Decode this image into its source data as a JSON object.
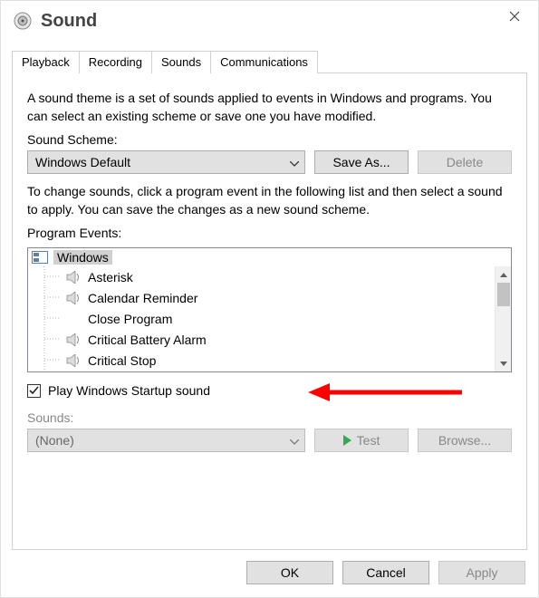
{
  "window": {
    "title": "Sound"
  },
  "tabs": [
    "Playback",
    "Recording",
    "Sounds",
    "Communications"
  ],
  "active_tab_index": 2,
  "intro": "A sound theme is a set of sounds applied to events in Windows and programs.  You can select an existing scheme or save one you have modified.",
  "scheme": {
    "label": "Sound Scheme:",
    "value": "Windows Default",
    "save_label": "Save As...",
    "delete_label": "Delete"
  },
  "events": {
    "intro": "To change sounds, click a program event in the following list and then select a sound to apply.  You can save the changes as a new sound scheme.",
    "label": "Program Events:",
    "root": "Windows",
    "items": [
      {
        "label": "Asterisk",
        "has_sound": true
      },
      {
        "label": "Calendar Reminder",
        "has_sound": true
      },
      {
        "label": "Close Program",
        "has_sound": false
      },
      {
        "label": "Critical Battery Alarm",
        "has_sound": true
      },
      {
        "label": "Critical Stop",
        "has_sound": true
      }
    ]
  },
  "startup": {
    "checked": true,
    "label": "Play Windows Startup sound"
  },
  "sound_picker": {
    "label": "Sounds:",
    "value": "(None)",
    "test_label": "Test",
    "browse_label": "Browse..."
  },
  "footer": {
    "ok": "OK",
    "cancel": "Cancel",
    "apply": "Apply"
  }
}
